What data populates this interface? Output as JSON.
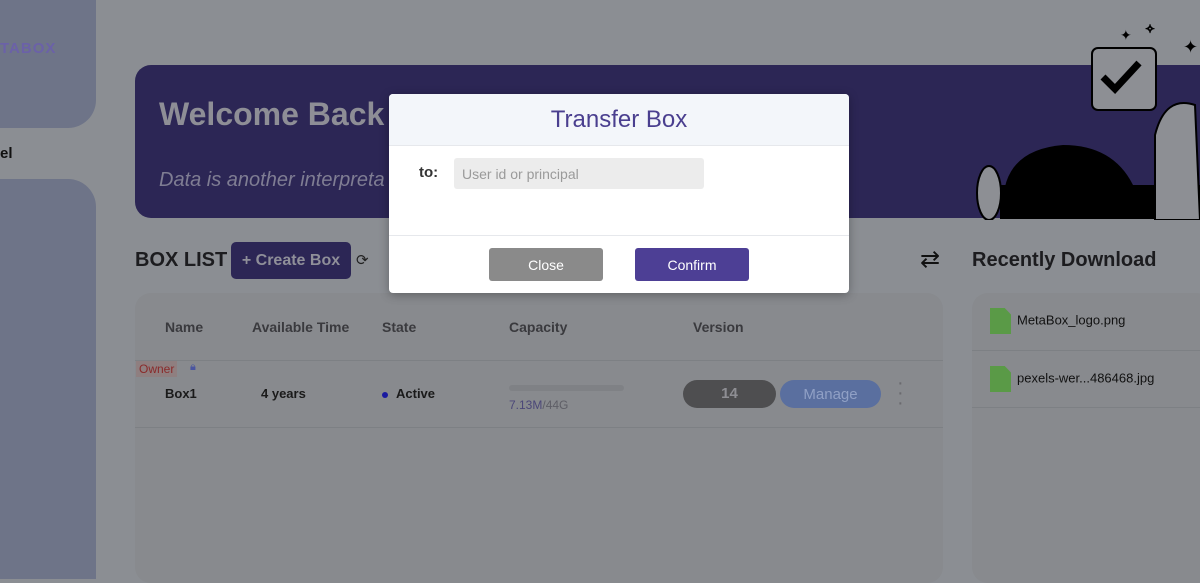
{
  "sidebar": {
    "logo": "TABOX",
    "nav_label": "el"
  },
  "banner": {
    "title": "Welcome Back",
    "tagline": "Data is another interpreta"
  },
  "box_list": {
    "title": "BOX LIST",
    "create_label": "+ Create Box",
    "refresh_icon": "refresh-icon",
    "columns": [
      "Name",
      "Available Time",
      "State",
      "Capacity",
      "Version"
    ],
    "rows": [
      {
        "badge": "Owner",
        "name": "Box1",
        "available_time": "4 years",
        "state": "Active",
        "capacity_used": "7.13M",
        "capacity_total": "/44G",
        "version": "14",
        "manage_label": "Manage"
      }
    ]
  },
  "recent": {
    "title": "Recently Download",
    "files": [
      "MetaBox_logo.png",
      "pexels-wer...486468.jpg"
    ]
  },
  "modal": {
    "title": "Transfer Box",
    "to_label": "to:",
    "placeholder": "User id or principal",
    "close_label": "Close",
    "confirm_label": "Confirm"
  }
}
